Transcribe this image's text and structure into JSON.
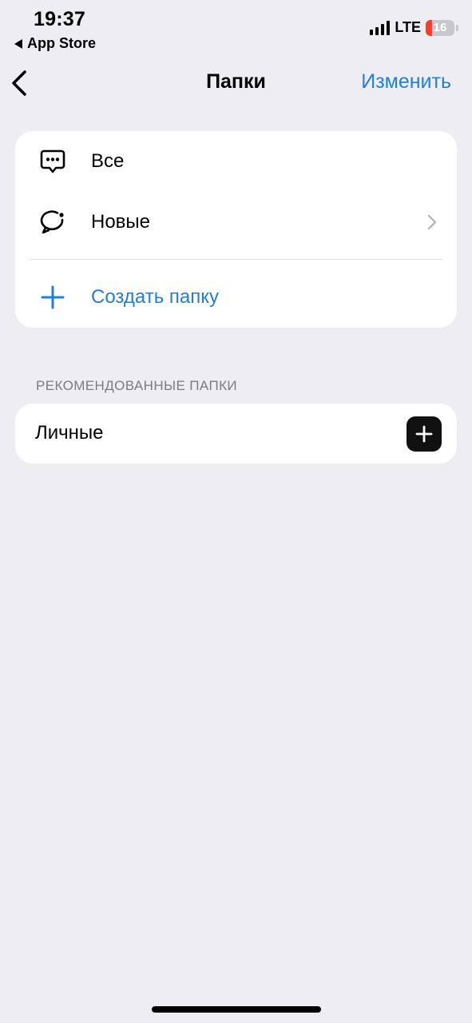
{
  "status_bar": {
    "time": "19:37",
    "back_app": "App Store",
    "network": "LTE",
    "battery": "16",
    "battery_level": 0.16
  },
  "nav": {
    "title": "Папки",
    "edit_label": "Изменить"
  },
  "folders": {
    "items": [
      {
        "label": "Все",
        "icon": "chat-bubble-dots-icon"
      },
      {
        "label": "Новые",
        "icon": "chat-bubble-new-icon"
      }
    ],
    "create_label": "Создать папку"
  },
  "suggested": {
    "header": "РЕКОМЕНДОВАННЫЕ ПАПКИ",
    "items": [
      {
        "label": "Личные"
      }
    ]
  },
  "colors": {
    "accent": "#1F7FD9",
    "background": "#EDEDF2",
    "card": "#FFFFFF",
    "secondary_text": "#7B7B80"
  }
}
